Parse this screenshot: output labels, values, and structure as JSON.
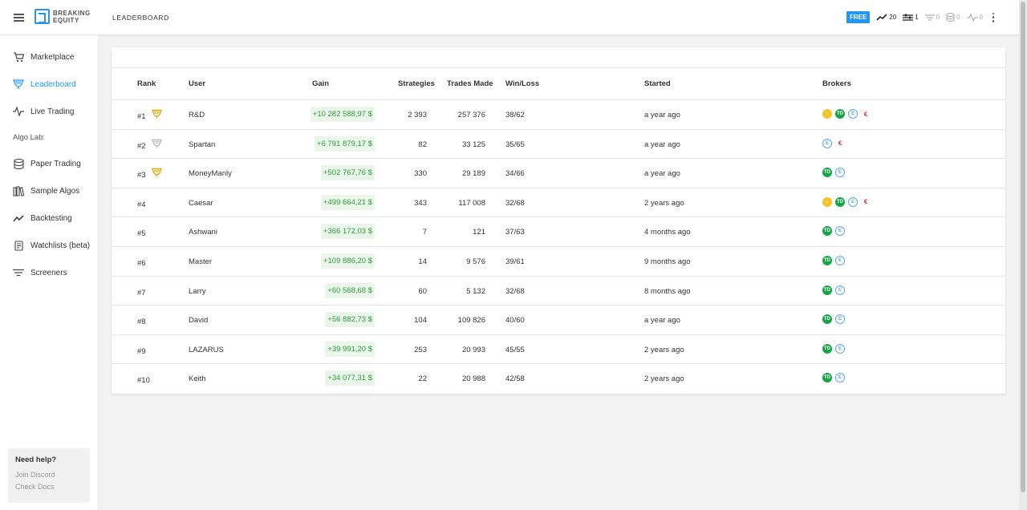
{
  "app": {
    "logo_line1": "BREAKING",
    "logo_line2": "EQUITY",
    "page_title": "LEADERBOARD"
  },
  "topbar": {
    "plan_badge": "FREE",
    "stats": [
      {
        "icon": "trend-line-icon",
        "value": "20"
      },
      {
        "icon": "sliders-icon",
        "value": "1"
      },
      {
        "icon": "filter-icon",
        "value": "0"
      },
      {
        "icon": "database-icon",
        "value": "0"
      },
      {
        "icon": "pulse-icon",
        "value": "0"
      }
    ]
  },
  "sidebar": {
    "items": [
      {
        "label": "Marketplace",
        "icon": "cart-icon"
      },
      {
        "label": "Leaderboard",
        "icon": "trophy-icon",
        "active": true
      },
      {
        "label": "Live Trading",
        "icon": "pulse-icon"
      }
    ],
    "section_label": "Algo Lab:",
    "lab_items": [
      {
        "label": "Paper Trading",
        "icon": "layers-icon"
      },
      {
        "label": "Sample Algos",
        "icon": "library-icon"
      },
      {
        "label": "Backtesting",
        "icon": "chart-line-icon"
      },
      {
        "label": "Watchlists (beta)",
        "icon": "document-icon"
      },
      {
        "label": "Screeners",
        "icon": "filter-lines-icon"
      }
    ],
    "help": {
      "title": "Need help?",
      "link1": "Join Discord",
      "link2": "Check Docs"
    }
  },
  "table": {
    "headers": {
      "rank": "Rank",
      "user": "User",
      "gain": "Gain",
      "strategies": "Strategies",
      "trades": "Trades Made",
      "winloss": "Win/Loss",
      "started": "Started",
      "brokers": "Brokers"
    },
    "rows": [
      {
        "rank": "#1",
        "trophy": "gold",
        "user": "R&D",
        "gain": "+10 282 588,97 $",
        "strategies": "2 393",
        "trades": "257 376",
        "winloss": "38/62",
        "started": "a year ago",
        "brokers": [
          "y",
          "td",
          "e",
          "r"
        ]
      },
      {
        "rank": "#2",
        "trophy": "silver",
        "user": "Spartan",
        "gain": "+6 791 879,17 $",
        "strategies": "82",
        "trades": "33 125",
        "winloss": "35/65",
        "started": "a year ago",
        "brokers": [
          "e",
          "r"
        ]
      },
      {
        "rank": "#3",
        "trophy": "bronze",
        "user": "MoneyManly",
        "gain": "+502 767,76 $",
        "strategies": "330",
        "trades": "29 189",
        "winloss": "34/66",
        "started": "a year ago",
        "brokers": [
          "td",
          "e"
        ]
      },
      {
        "rank": "#4",
        "trophy": "",
        "user": "Caesar",
        "gain": "+499 664,21 $",
        "strategies": "343",
        "trades": "117 008",
        "winloss": "32/68",
        "started": "2 years ago",
        "brokers": [
          "y",
          "td",
          "e",
          "r"
        ]
      },
      {
        "rank": "#5",
        "trophy": "",
        "user": "Ashwani",
        "gain": "+366 172,03 $",
        "strategies": "7",
        "trades": "121",
        "winloss": "37/63",
        "started": "4 months ago",
        "brokers": [
          "td",
          "e"
        ]
      },
      {
        "rank": "#6",
        "trophy": "",
        "user": "Master",
        "gain": "+109 886,20 $",
        "strategies": "14",
        "trades": "9 576",
        "winloss": "39/61",
        "started": "9 months ago",
        "brokers": [
          "td",
          "e"
        ]
      },
      {
        "rank": "#7",
        "trophy": "",
        "user": "Larry",
        "gain": "+60 568,68 $",
        "strategies": "60",
        "trades": "5 132",
        "winloss": "32/68",
        "started": "8 months ago",
        "brokers": [
          "td",
          "e"
        ]
      },
      {
        "rank": "#8",
        "trophy": "",
        "user": "David",
        "gain": "+56 882,73 $",
        "strategies": "104",
        "trades": "109 826",
        "winloss": "40/60",
        "started": "a year ago",
        "brokers": [
          "td",
          "e"
        ]
      },
      {
        "rank": "#9",
        "trophy": "",
        "user": "LAZARUS",
        "gain": "+39 991,20 $",
        "strategies": "253",
        "trades": "20 993",
        "winloss": "45/55",
        "started": "2 years ago",
        "brokers": [
          "td",
          "e"
        ]
      },
      {
        "rank": "#10",
        "trophy": "",
        "user": "Keith",
        "gain": "+34 077,31 $",
        "strategies": "22",
        "trades": "20 988",
        "winloss": "42/58",
        "started": "2 years ago",
        "brokers": [
          "td",
          "e"
        ]
      }
    ]
  },
  "colors": {
    "accent": "#2196f3",
    "gain_text": "#2e9d3a",
    "gain_bg": "#eaf6ea",
    "trophy_gold": "#e0a800",
    "trophy_silver": "#b9b9b9"
  }
}
